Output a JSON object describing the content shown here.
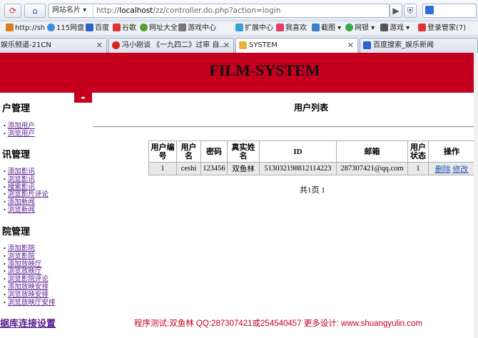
{
  "browser": {
    "site_id": "网站名片",
    "url_prefix": "http://",
    "url_host": "localhost",
    "url_path": "/zz/controller.do.php?action=login"
  },
  "bookmarks": [
    "http://sh",
    "115网盘",
    "百度",
    "谷歌",
    "网址大全",
    "游戏中心",
    "扩展中心",
    "我喜欢",
    "截图",
    "网银",
    "游戏",
    "登录管家(7)"
  ],
  "tabs": [
    {
      "label": "娱乐频道-21CN",
      "active": false
    },
    {
      "label": "冯小刚谈 《一九四二》过审 自…",
      "active": false
    },
    {
      "label": "SYSTEM",
      "active": true
    },
    {
      "label": "百度搜索_娱乐新闻",
      "active": false
    }
  ],
  "header": {
    "title": "FILM-SYSTEM"
  },
  "sidebar": {
    "sections": [
      {
        "title": "户管理",
        "items": [
          "添加用户",
          "浏览用户"
        ]
      },
      {
        "title": "讯管理",
        "items": [
          "添加影讯",
          "浏览影讯",
          "搜索影讯",
          "浏览影片评论",
          "添加新闻",
          "浏览新闻"
        ]
      },
      {
        "title": "院管理",
        "items": [
          "添加影院",
          "浏览影院",
          "添加放映厅",
          "浏览放映厅",
          "浏览影院评论",
          "添加放映安排",
          "浏览放映安排",
          "浏览放映厅安排"
        ]
      }
    ],
    "db_link": "据库连接设置"
  },
  "main": {
    "list_title": "用户列表",
    "table": {
      "headers": [
        "用户编号",
        "用户名",
        "密码",
        "真实姓名",
        "ID",
        "邮箱",
        "用户状态",
        "操作"
      ],
      "rows": [
        {
          "id": "1",
          "username": "ceshi",
          "password": "123456",
          "realname": "双鱼林",
          "idno": "513032198812114223",
          "email": "287307421@qq.com",
          "status": "1",
          "delete": "删除",
          "edit": "修改"
        }
      ]
    },
    "pager": "共1页  1",
    "footer": "程序测试:双鱼林 QQ:287307421或254540457 更多设计: www.shuangyulin.com"
  }
}
